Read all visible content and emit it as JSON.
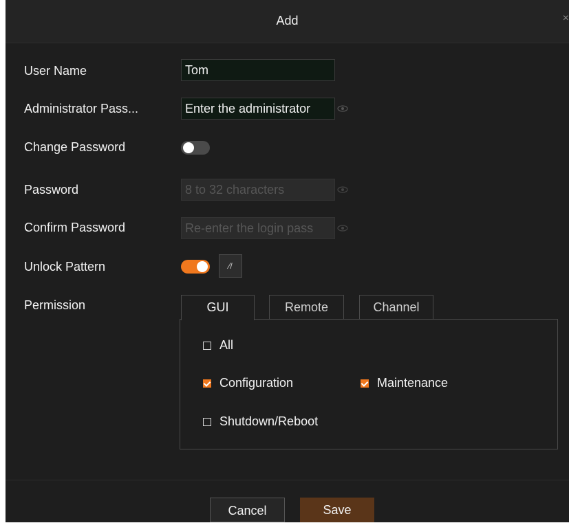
{
  "dialog": {
    "title": "Add",
    "close_icon": "×"
  },
  "form": {
    "user_name_label": "User Name",
    "user_name_value": "Tom",
    "admin_password_label": "Administrator Pass...",
    "admin_password_placeholder": "Enter the administrator",
    "change_password_label": "Change Password",
    "change_password_enabled": false,
    "password_label": "Password",
    "password_placeholder": "8 to 32 characters",
    "confirm_password_label": "Confirm Password",
    "confirm_password_placeholder": "Re-enter the login pass",
    "unlock_pattern_label": "Unlock Pattern",
    "unlock_pattern_enabled": true,
    "pattern_button_glyph": "⁄/",
    "permission_label": "Permission"
  },
  "permission": {
    "tabs": [
      {
        "label": "GUI",
        "active": true
      },
      {
        "label": "Remote",
        "active": false
      },
      {
        "label": "Channel",
        "active": false
      }
    ],
    "options": {
      "all": {
        "label": "All",
        "checked": false
      },
      "configuration": {
        "label": "Configuration",
        "checked": true
      },
      "maintenance": {
        "label": "Maintenance",
        "checked": true
      },
      "shutdown": {
        "label": "Shutdown/Reboot",
        "checked": false
      }
    }
  },
  "footer": {
    "cancel_label": "Cancel",
    "save_label": "Save"
  },
  "colors": {
    "accent": "#f0781e",
    "background": "#1e1e1e",
    "save_button": "#5a3519"
  },
  "icons": {
    "eye": "eye-icon",
    "close": "close-icon",
    "pattern": "unlock-pattern-icon"
  }
}
